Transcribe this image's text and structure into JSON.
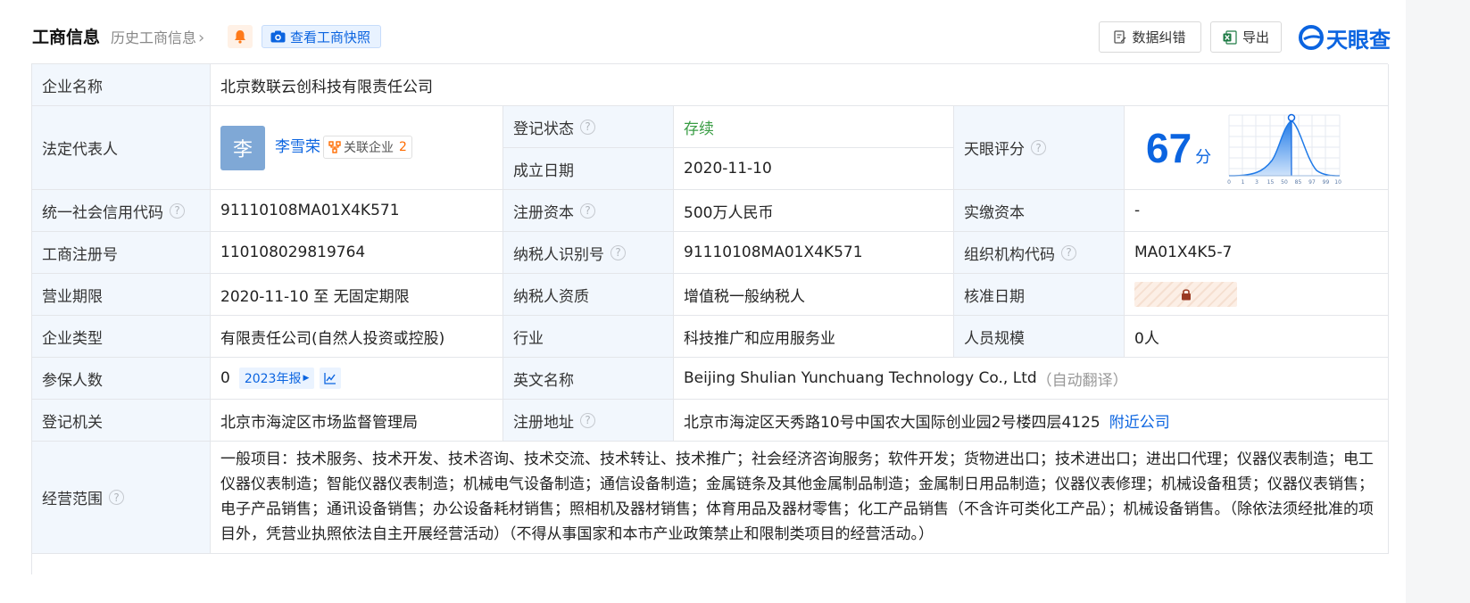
{
  "header": {
    "title": "工商信息",
    "history_link": "历史工商信息",
    "snapshot_label": "查看工商快照",
    "correct_label": "数据纠错",
    "export_label": "导出",
    "logo_text": "天眼查"
  },
  "rows": {
    "company_name": {
      "label": "企业名称",
      "value": "北京数联云创科技有限责任公司"
    },
    "legal_rep": {
      "label": "法定代表人",
      "avatar_char": "李",
      "name": "李雪荣",
      "related_label": "关联企业",
      "related_count": "2"
    },
    "reg_status": {
      "label": "登记状态",
      "value": "存续"
    },
    "found_date": {
      "label": "成立日期",
      "value": "2020-11-10"
    },
    "score": {
      "label": "天眼评分",
      "value": "67",
      "unit": "分",
      "ticks": [
        "0",
        "1",
        "3",
        "15",
        "50",
        "85",
        "97",
        "99",
        "100"
      ]
    },
    "credit_code": {
      "label": "统一社会信用代码",
      "value": "91110108MA01X4K571"
    },
    "reg_capital": {
      "label": "注册资本",
      "value": "500万人民币"
    },
    "paid_capital": {
      "label": "实缴资本",
      "value": "-"
    },
    "reg_no": {
      "label": "工商注册号",
      "value": "110108029819764"
    },
    "taxpayer_id": {
      "label": "纳税人识别号",
      "value": "91110108MA01X4K571"
    },
    "org_code": {
      "label": "组织机构代码",
      "value": "MA01X4K5-7"
    },
    "term": {
      "label": "营业期限",
      "value": "2020-11-10 至 无固定期限"
    },
    "taxpayer_qual": {
      "label": "纳税人资质",
      "value": "增值税一般纳税人"
    },
    "approval_date": {
      "label": "核准日期"
    },
    "company_type": {
      "label": "企业类型",
      "value": "有限责任公司(自然人投资或控股)"
    },
    "industry": {
      "label": "行业",
      "value": "科技推广和应用服务业"
    },
    "staff_size": {
      "label": "人员规模",
      "value": "0人"
    },
    "insured": {
      "label": "参保人数",
      "value": "0",
      "report_label": "2023年报"
    },
    "english_name": {
      "label": "英文名称",
      "value": "Beijing Shulian Yunchuang Technology Co., Ltd",
      "note": "（自动翻译）"
    },
    "reg_authority": {
      "label": "登记机关",
      "value": "北京市海淀区市场监督管理局"
    },
    "reg_address": {
      "label": "注册地址",
      "value": "北京市海淀区天秀路10号中国农大国际创业园2号楼四层4125",
      "nearby_label": "附近公司"
    },
    "business_scope": {
      "label": "经营范围",
      "value": "一般项目：技术服务、技术开发、技术咨询、技术交流、技术转让、技术推广；社会经济咨询服务；软件开发；货物进出口；技术进出口；进出口代理；仪器仪表制造；电工仪器仪表制造；智能仪器仪表制造；机械电气设备制造；通信设备制造；金属链条及其他金属制品制造；金属制日用品制造；仪器仪表修理；机械设备租赁；仪器仪表销售；电子产品销售；通讯设备销售；办公设备耗材销售；照相机及器材销售；体育用品及器材零售；化工产品销售（不含许可类化工产品）；机械设备销售。（除依法须经批准的项目外，凭营业执照依法自主开展经营活动）（不得从事国家和本市产业政策禁止和限制类项目的经营活动。）"
    }
  },
  "colors": {
    "brand_blue": "#0b64e0",
    "label_bg": "#f2f7fd",
    "status_green": "#3a9d45",
    "orange": "#ff6b00"
  }
}
